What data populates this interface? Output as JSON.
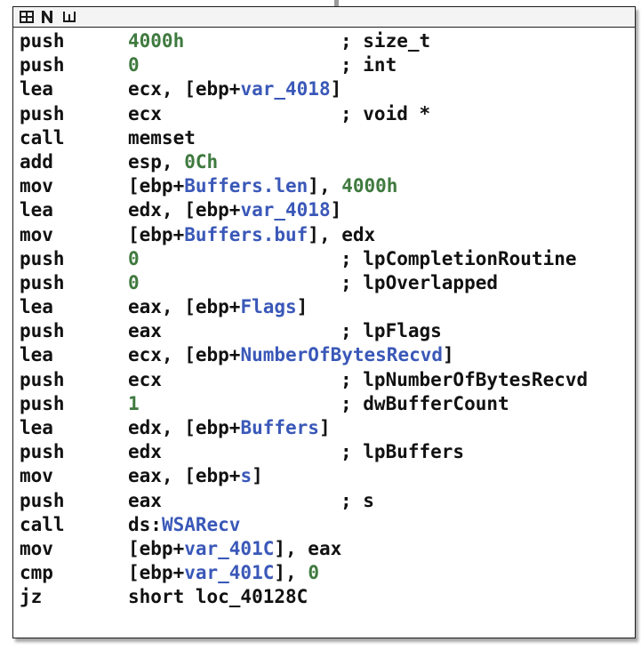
{
  "colors": {
    "text": "#111111",
    "immediate": "#3f7a3f",
    "symbol": "#3a58b8",
    "background": "#ffffff"
  },
  "toolbar": {
    "icons": [
      "grid-view-icon",
      "n-mode-icon",
      "graph-mode-icon"
    ]
  },
  "lines": [
    {
      "mn": "push",
      "op": [
        {
          "t": "4000h",
          "c": "imm"
        }
      ],
      "cm": "; size_t"
    },
    {
      "mn": "push",
      "op": [
        {
          "t": "0",
          "c": "imm"
        }
      ],
      "cm": "; int"
    },
    {
      "mn": "lea",
      "op": [
        {
          "t": "ecx, [ebp+",
          "c": "plain"
        },
        {
          "t": "var_4018",
          "c": "sym"
        },
        {
          "t": "]",
          "c": "plain"
        }
      ],
      "cm": ""
    },
    {
      "mn": "push",
      "op": [
        {
          "t": "ecx",
          "c": "plain"
        }
      ],
      "cm": "; void *"
    },
    {
      "mn": "call",
      "op": [
        {
          "t": "memset",
          "c": "plain"
        }
      ],
      "cm": ""
    },
    {
      "mn": "add",
      "op": [
        {
          "t": "esp, ",
          "c": "plain"
        },
        {
          "t": "0Ch",
          "c": "imm"
        }
      ],
      "cm": ""
    },
    {
      "mn": "mov",
      "op": [
        {
          "t": "[ebp+",
          "c": "plain"
        },
        {
          "t": "Buffers.len",
          "c": "sym"
        },
        {
          "t": "], ",
          "c": "plain"
        },
        {
          "t": "4000h",
          "c": "imm"
        }
      ],
      "cm": ""
    },
    {
      "mn": "lea",
      "op": [
        {
          "t": "edx, [ebp+",
          "c": "plain"
        },
        {
          "t": "var_4018",
          "c": "sym"
        },
        {
          "t": "]",
          "c": "plain"
        }
      ],
      "cm": ""
    },
    {
      "mn": "mov",
      "op": [
        {
          "t": "[ebp+",
          "c": "plain"
        },
        {
          "t": "Buffers.buf",
          "c": "sym"
        },
        {
          "t": "], edx",
          "c": "plain"
        }
      ],
      "cm": ""
    },
    {
      "mn": "push",
      "op": [
        {
          "t": "0",
          "c": "imm"
        }
      ],
      "cm": "; lpCompletionRoutine"
    },
    {
      "mn": "push",
      "op": [
        {
          "t": "0",
          "c": "imm"
        }
      ],
      "cm": "; lpOverlapped"
    },
    {
      "mn": "lea",
      "op": [
        {
          "t": "eax, [ebp+",
          "c": "plain"
        },
        {
          "t": "Flags",
          "c": "sym"
        },
        {
          "t": "]",
          "c": "plain"
        }
      ],
      "cm": ""
    },
    {
      "mn": "push",
      "op": [
        {
          "t": "eax",
          "c": "plain"
        }
      ],
      "cm": "; lpFlags"
    },
    {
      "mn": "lea",
      "op": [
        {
          "t": "ecx, [ebp+",
          "c": "plain"
        },
        {
          "t": "NumberOfBytesRecvd",
          "c": "sym"
        },
        {
          "t": "]",
          "c": "plain"
        }
      ],
      "cm": ""
    },
    {
      "mn": "push",
      "op": [
        {
          "t": "ecx",
          "c": "plain"
        }
      ],
      "cm": "; lpNumberOfBytesRecvd"
    },
    {
      "mn": "push",
      "op": [
        {
          "t": "1",
          "c": "imm"
        }
      ],
      "cm": "; dwBufferCount"
    },
    {
      "mn": "lea",
      "op": [
        {
          "t": "edx, [ebp+",
          "c": "plain"
        },
        {
          "t": "Buffers",
          "c": "sym"
        },
        {
          "t": "]",
          "c": "plain"
        }
      ],
      "cm": ""
    },
    {
      "mn": "push",
      "op": [
        {
          "t": "edx",
          "c": "plain"
        }
      ],
      "cm": "; lpBuffers"
    },
    {
      "mn": "mov",
      "op": [
        {
          "t": "eax, [ebp+",
          "c": "plain"
        },
        {
          "t": "s",
          "c": "sym"
        },
        {
          "t": "]",
          "c": "plain"
        }
      ],
      "cm": ""
    },
    {
      "mn": "push",
      "op": [
        {
          "t": "eax",
          "c": "plain"
        }
      ],
      "cm": "; s"
    },
    {
      "mn": "call",
      "op": [
        {
          "t": "ds:",
          "c": "plain"
        },
        {
          "t": "WSARecv",
          "c": "sym"
        }
      ],
      "cm": ""
    },
    {
      "mn": "mov",
      "op": [
        {
          "t": "[ebp+",
          "c": "plain"
        },
        {
          "t": "var_401C",
          "c": "sym"
        },
        {
          "t": "], eax",
          "c": "plain"
        }
      ],
      "cm": ""
    },
    {
      "mn": "cmp",
      "op": [
        {
          "t": "[ebp+",
          "c": "plain"
        },
        {
          "t": "var_401C",
          "c": "sym"
        },
        {
          "t": "], ",
          "c": "plain"
        },
        {
          "t": "0",
          "c": "imm"
        }
      ],
      "cm": ""
    },
    {
      "mn": "jz",
      "op": [
        {
          "t": "short loc_40128C",
          "c": "plain"
        }
      ],
      "cm": ""
    }
  ]
}
